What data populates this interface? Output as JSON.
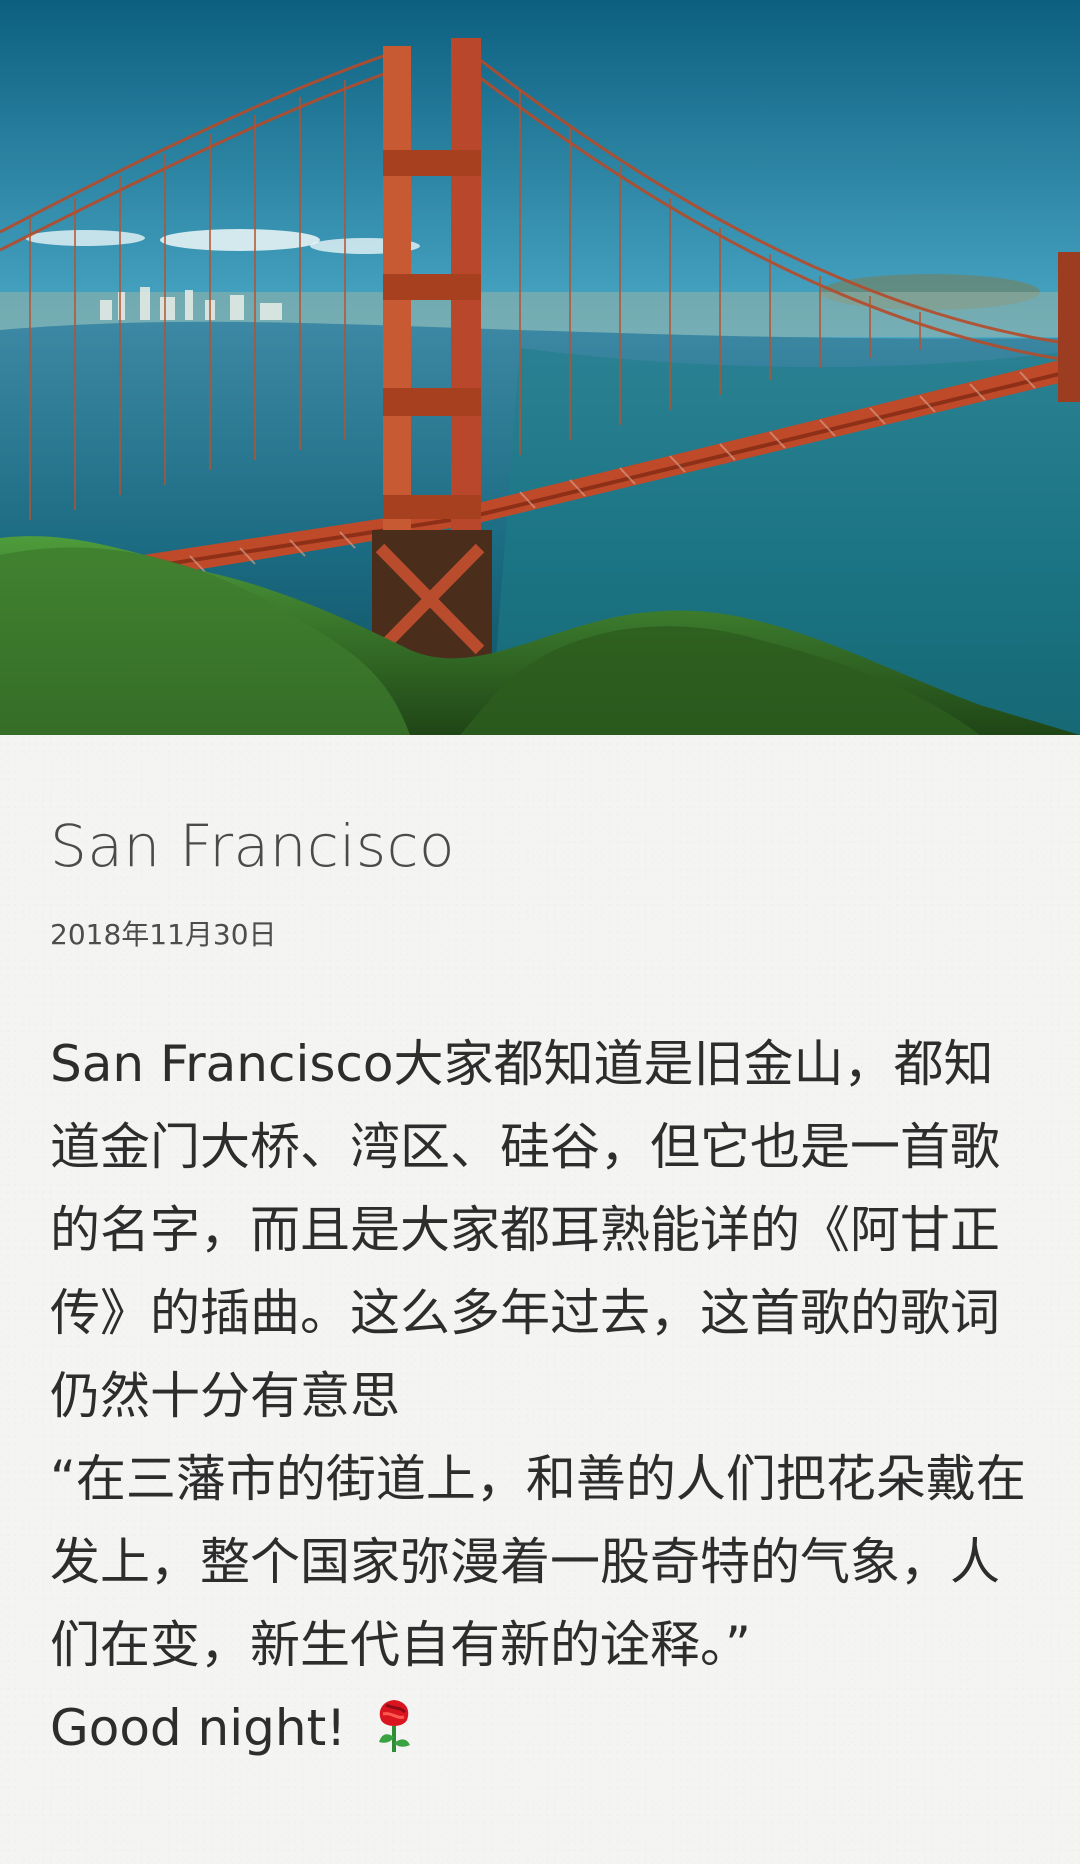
{
  "article": {
    "title": "San Francisco",
    "date": "2018年11月30日",
    "paragraph_1": "San Francisco大家都知道是旧金山，都知道金门大桥、湾区、硅谷，但它也是一首歌的名字，而且是大家都耳熟能详的《阿甘正传》的插曲。这么多年过去，这首歌的歌词仍然十分有意思",
    "quote": "“在三藩市的街道上，和善的人们把花朵戴在发上，整个国家弥漫着一股奇特的气象，人们在变，新生代自有新的诠释。”",
    "closing": "Good night!"
  },
  "icons": {
    "rose": "rose-icon"
  },
  "colors": {
    "background": "#f4f4f2",
    "bridge": "#c9502b",
    "sky_top": "#2a6f8f",
    "water": "#1c5e77",
    "grass": "#2f6a20"
  }
}
